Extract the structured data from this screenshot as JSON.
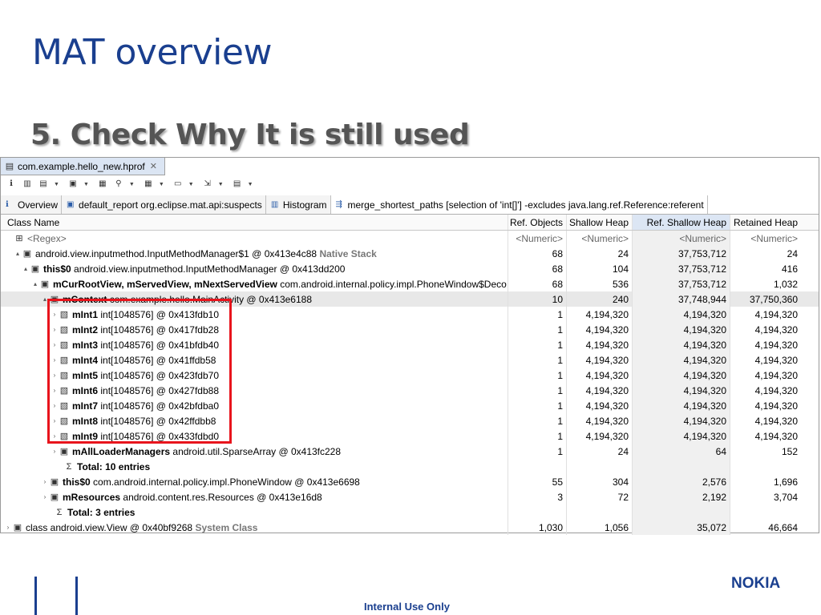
{
  "slide": {
    "title": "MAT overview",
    "subtitle": "5. Check Why It is still used",
    "footer": "Internal Use Only",
    "logo": "NOKIA"
  },
  "editor_tab": {
    "label": "com.example.hello_new.hprof",
    "close": "✕"
  },
  "toolbar_icons": [
    "info-icon",
    "bar-chart-icon",
    "database-icon",
    "query-icon",
    "oql-icon",
    "search-icon",
    "grid-icon",
    "layout-icon",
    "export-icon",
    "settings-icon"
  ],
  "view_tabs": [
    {
      "label": "Overview",
      "icon": "info-icon"
    },
    {
      "label": "default_report  org.eclipse.mat.api:suspects",
      "icon": "report-icon"
    },
    {
      "label": "Histogram",
      "icon": "histogram-icon"
    },
    {
      "label": "merge_shortest_paths [selection of 'int[]'] -excludes java.lang.ref.Reference:referent",
      "icon": "paths-icon"
    }
  ],
  "columns": {
    "name": "Class Name",
    "ref_objects": "Ref. Objects",
    "shallow_heap": "Shallow Heap",
    "ref_shallow_heap": "Ref. Shallow Heap",
    "retained_heap": "Retained Heap"
  },
  "filter_row": {
    "name": "<Regex>",
    "c1": "<Numeric>",
    "c2": "<Numeric>",
    "c3": "<Numeric>",
    "c4": "<Numeric>"
  },
  "rows": [
    {
      "bold": "",
      "rest": "android.view.inputmethod.InputMethodManager$1 @ 0x413e4c88",
      "tag": "Native Stack",
      "c1": "68",
      "c2": "24",
      "c3": "37,753,712",
      "c4": "24"
    },
    {
      "bold": "this$0",
      "rest": "android.view.inputmethod.InputMethodManager @ 0x413dd200",
      "tag": "",
      "c1": "68",
      "c2": "104",
      "c3": "37,753,712",
      "c4": "416"
    },
    {
      "bold": "mCurRootView, mServedView, mNextServedView",
      "rest": "com.android.internal.policy.impl.PhoneWindow$Deco",
      "tag": "",
      "c1": "68",
      "c2": "536",
      "c3": "37,753,712",
      "c4": "1,032"
    },
    {
      "bold": "mContext",
      "rest": "com.example.hello.MainActivity @ 0x413e6188",
      "tag": "",
      "c1": "10",
      "c2": "240",
      "c3": "37,748,944",
      "c4": "37,750,360"
    },
    {
      "bold": "mInt1",
      "rest": "int[1048576] @ 0x413fdb10",
      "tag": "",
      "c1": "1",
      "c2": "4,194,320",
      "c3": "4,194,320",
      "c4": "4,194,320"
    },
    {
      "bold": "mInt2",
      "rest": "int[1048576] @ 0x417fdb28",
      "tag": "",
      "c1": "1",
      "c2": "4,194,320",
      "c3": "4,194,320",
      "c4": "4,194,320"
    },
    {
      "bold": "mInt3",
      "rest": "int[1048576] @ 0x41bfdb40",
      "tag": "",
      "c1": "1",
      "c2": "4,194,320",
      "c3": "4,194,320",
      "c4": "4,194,320"
    },
    {
      "bold": "mInt4",
      "rest": "int[1048576] @ 0x41ffdb58",
      "tag": "",
      "c1": "1",
      "c2": "4,194,320",
      "c3": "4,194,320",
      "c4": "4,194,320"
    },
    {
      "bold": "mInt5",
      "rest": "int[1048576] @ 0x423fdb70",
      "tag": "",
      "c1": "1",
      "c2": "4,194,320",
      "c3": "4,194,320",
      "c4": "4,194,320"
    },
    {
      "bold": "mInt6",
      "rest": "int[1048576] @ 0x427fdb88",
      "tag": "",
      "c1": "1",
      "c2": "4,194,320",
      "c3": "4,194,320",
      "c4": "4,194,320"
    },
    {
      "bold": "mInt7",
      "rest": "int[1048576] @ 0x42bfdba0",
      "tag": "",
      "c1": "1",
      "c2": "4,194,320",
      "c3": "4,194,320",
      "c4": "4,194,320"
    },
    {
      "bold": "mInt8",
      "rest": "int[1048576] @ 0x42ffdbb8",
      "tag": "",
      "c1": "1",
      "c2": "4,194,320",
      "c3": "4,194,320",
      "c4": "4,194,320"
    },
    {
      "bold": "mInt9",
      "rest": "int[1048576] @ 0x433fdbd0",
      "tag": "",
      "c1": "1",
      "c2": "4,194,320",
      "c3": "4,194,320",
      "c4": "4,194,320"
    },
    {
      "bold": "mAllLoaderManagers",
      "rest": "android.util.SparseArray @ 0x413fc228",
      "tag": "",
      "c1": "1",
      "c2": "24",
      "c3": "64",
      "c4": "152"
    },
    {
      "bold": "Total: 10 entries",
      "rest": "",
      "tag": "",
      "c1": "",
      "c2": "",
      "c3": "",
      "c4": ""
    },
    {
      "bold": "this$0",
      "rest": "com.android.internal.policy.impl.PhoneWindow @ 0x413e6698",
      "tag": "",
      "c1": "55",
      "c2": "304",
      "c3": "2,576",
      "c4": "1,696"
    },
    {
      "bold": "mResources",
      "rest": "android.content.res.Resources @ 0x413e16d8",
      "tag": "",
      "c1": "3",
      "c2": "72",
      "c3": "2,192",
      "c4": "3,704"
    },
    {
      "bold": "Total: 3 entries",
      "rest": "",
      "tag": "",
      "c1": "",
      "c2": "",
      "c3": "",
      "c4": ""
    },
    {
      "bold": "",
      "rest": "class android.view.View @ 0x40bf9268",
      "tag": "System Class",
      "c1": "1,030",
      "c2": "1,056",
      "c3": "35,072",
      "c4": "46,664"
    }
  ],
  "colors": {
    "title": "#1a3f8f",
    "highlight_box": "#e8141c",
    "selected_row": "#e8e8e8"
  }
}
